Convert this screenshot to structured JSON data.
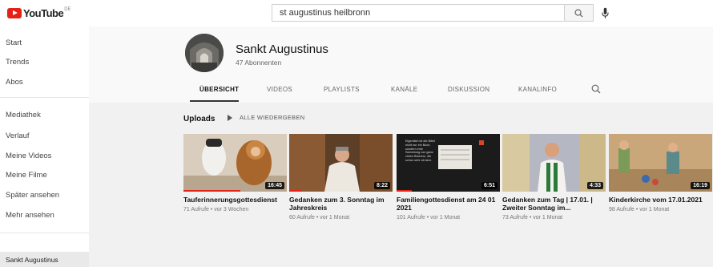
{
  "header": {
    "logo_text": "YouTube",
    "logo_country": "DE",
    "search_value": "st augustinus heilbronn",
    "search_icon": "search-icon",
    "mic_icon": "mic-icon"
  },
  "sidebar": {
    "items": [
      "Start",
      "Trends",
      "Abos",
      "Mediathek",
      "Verlauf",
      "Meine Videos",
      "Meine Filme",
      "Später ansehen",
      "Mehr ansehen"
    ],
    "subscription": "Sankt Augustinus"
  },
  "channel": {
    "name": "Sankt Augustinus",
    "subscribers": "47 Abonnenten",
    "tabs": [
      "ÜBERSICHT",
      "VIDEOS",
      "PLAYLISTS",
      "KANÄLE",
      "DISKUSSION",
      "KANALINFO"
    ],
    "active_tab": "ÜBERSICHT"
  },
  "uploads": {
    "label": "Uploads",
    "play_all": "ALLE WIEDERGEBEN",
    "videos": [
      {
        "title": "Tauferinnerungsgottesdienst",
        "meta": "71 Aufrufe • vor 3 Wochen",
        "duration": "16:45",
        "watched": 0.55
      },
      {
        "title": "Gedanken zum 3. Sonntag im Jahreskreis",
        "meta": "60 Aufrufe • vor 1 Monat",
        "duration": "8:22",
        "watched": 0.12
      },
      {
        "title": "Familiengottesdienst am 24 01 2021",
        "meta": "101 Aufrufe • vor 1 Monat",
        "duration": "6:51",
        "watched": 0.15
      },
      {
        "title": "Gedanken zum Tag | 17.01. | Zweiter Sonntag im...",
        "meta": "73 Aufrufe • vor 1 Monat",
        "duration": "4:33",
        "watched": 0.0
      },
      {
        "title": "Kinderkirche vom 17.01.2021",
        "meta": "98 Aufrufe • vor 1 Monat",
        "duration": "16:19",
        "watched": 0.0
      }
    ]
  },
  "thumb_text": "Eigentlich ist die Bibel nicht nur ein Buch, sondern eine Sammlung von ganz vielen Büchern, die schon sehr alt sind.",
  "colors": {
    "brand": "#e62117",
    "active_nav": "#e9e9e9",
    "main_bg": "#f1f1f1"
  }
}
